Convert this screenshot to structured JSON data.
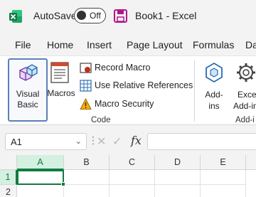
{
  "titlebar": {
    "autosave_label": "AutoSave",
    "autosave_state": "Off",
    "title": "Book1  -  Excel"
  },
  "menu": [
    "File",
    "Home",
    "Insert",
    "Page Layout",
    "Formulas",
    "Da"
  ],
  "ribbon": {
    "visual_basic": [
      "Visual",
      "Basic"
    ],
    "macros": "Macros",
    "record_macro": "Record Macro",
    "relative_refs": "Use Relative References",
    "macro_security": "Macro Security",
    "code_group": "Code",
    "addins": [
      "Add-",
      "ins"
    ],
    "excel_addins": [
      "Exce",
      "Add-in"
    ],
    "addins_group": "Add-i"
  },
  "formula_bar": {
    "name_box": "A1",
    "fx": "fx",
    "value": ""
  },
  "grid": {
    "columns": [
      "A",
      "B",
      "C",
      "D",
      "E"
    ],
    "rows": [
      "1",
      "2"
    ],
    "active_cell": "A1"
  },
  "colors": {
    "excel_green": "#107c41",
    "selection_blue": "#5b7fb9"
  }
}
